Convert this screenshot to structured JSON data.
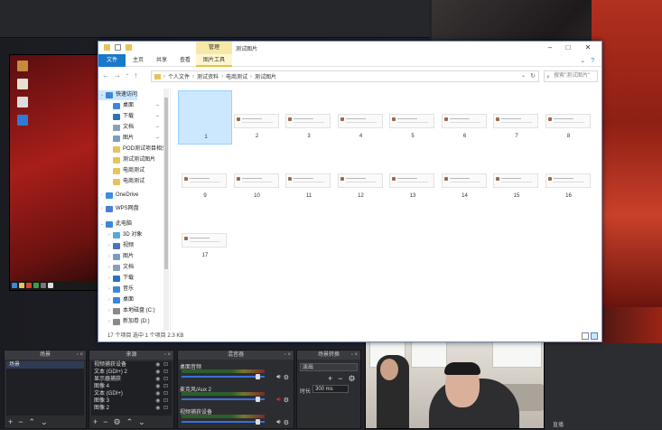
{
  "explorer": {
    "manage_tab": "管理",
    "window_title": "测试图片",
    "ribbon_tabs": [
      "文件",
      "主页",
      "共享",
      "查看",
      "图片工具"
    ],
    "address": [
      "个人文件",
      "测试资料",
      "电商测试",
      "测试图片"
    ],
    "search_placeholder": "搜索\"测试图片\"",
    "nav_items": [
      {
        "label": "快速访问",
        "chev": "v",
        "color": "#3d87d6",
        "pin": ""
      },
      {
        "label": "桌面",
        "chev": "",
        "color": "#3d87d6",
        "pin": "📌"
      },
      {
        "label": "下载",
        "chev": "",
        "color": "#2f6fc0",
        "pin": "📌"
      },
      {
        "label": "文档",
        "chev": "",
        "color": "#8aa0b8",
        "pin": "📌"
      },
      {
        "label": "图片",
        "chev": "",
        "color": "#7a9cc8",
        "pin": "📌"
      },
      {
        "label": "POD测试项目相关",
        "chev": "",
        "color": "#e8c35a",
        "pin": ""
      },
      {
        "label": "测试测试图片",
        "chev": "",
        "color": "#e8c35a",
        "pin": ""
      },
      {
        "label": "电商测试",
        "chev": "",
        "color": "#e8c35a",
        "pin": ""
      },
      {
        "label": "电商测试",
        "chev": "",
        "color": "#e8c35a",
        "pin": ""
      },
      {
        "label": "OneDrive",
        "chev": ">",
        "color": "#3a8ee6",
        "pin": ""
      },
      {
        "label": "WPS网盘",
        "chev": ">",
        "color": "#4a7fd9",
        "pin": ""
      },
      {
        "label": "此电脑",
        "chev": "v",
        "color": "#3d87d6",
        "pin": ""
      },
      {
        "label": "3D 对象",
        "chev": ">",
        "color": "#57a6e0",
        "pin": ""
      },
      {
        "label": "视频",
        "chev": ">",
        "color": "#4a74b8",
        "pin": ""
      },
      {
        "label": "图片",
        "chev": ">",
        "color": "#7a9cc8",
        "pin": ""
      },
      {
        "label": "文档",
        "chev": ">",
        "color": "#8aa0b8",
        "pin": ""
      },
      {
        "label": "下载",
        "chev": ">",
        "color": "#2f6fc0",
        "pin": ""
      },
      {
        "label": "音乐",
        "chev": ">",
        "color": "#3d87d6",
        "pin": ""
      },
      {
        "label": "桌面",
        "chev": ">",
        "color": "#3d87d6",
        "pin": ""
      },
      {
        "label": "本地磁盘 (C:)",
        "chev": ">",
        "color": "#8a8a8a",
        "pin": ""
      },
      {
        "label": "新加卷 (D:)",
        "chev": ">",
        "color": "#8a8a8a",
        "pin": ""
      }
    ],
    "files": [
      "1",
      "2",
      "3",
      "4",
      "5",
      "6",
      "7",
      "8",
      "9",
      "10",
      "11",
      "12",
      "13",
      "14",
      "15",
      "16",
      "17"
    ],
    "status": "17 个项目    选中 1 个项目  2.3 KB"
  },
  "obs": {
    "scenes_title": "场景",
    "scenes": [
      "场景"
    ],
    "sources_title": "来源",
    "sources": [
      "视频捕获设备",
      "文本 (GDI+) 2",
      "显示器捕获",
      "图像 4",
      "文本 (GDI+)",
      "图像 3",
      "图像 2"
    ],
    "mixer_title": "混音器",
    "mixer": [
      {
        "name": "桌面音频",
        "knob": 0.88,
        "muted": false
      },
      {
        "name": "麦克风/Aux 2",
        "knob": 0.88,
        "muted": true
      },
      {
        "name": "视频捕获设备",
        "knob": 0.88,
        "muted": false
      }
    ],
    "transitions_title": "场景转换",
    "transition": "淡出",
    "duration_label": "时长",
    "duration_value": "300 ms",
    "right_text": "直播"
  }
}
